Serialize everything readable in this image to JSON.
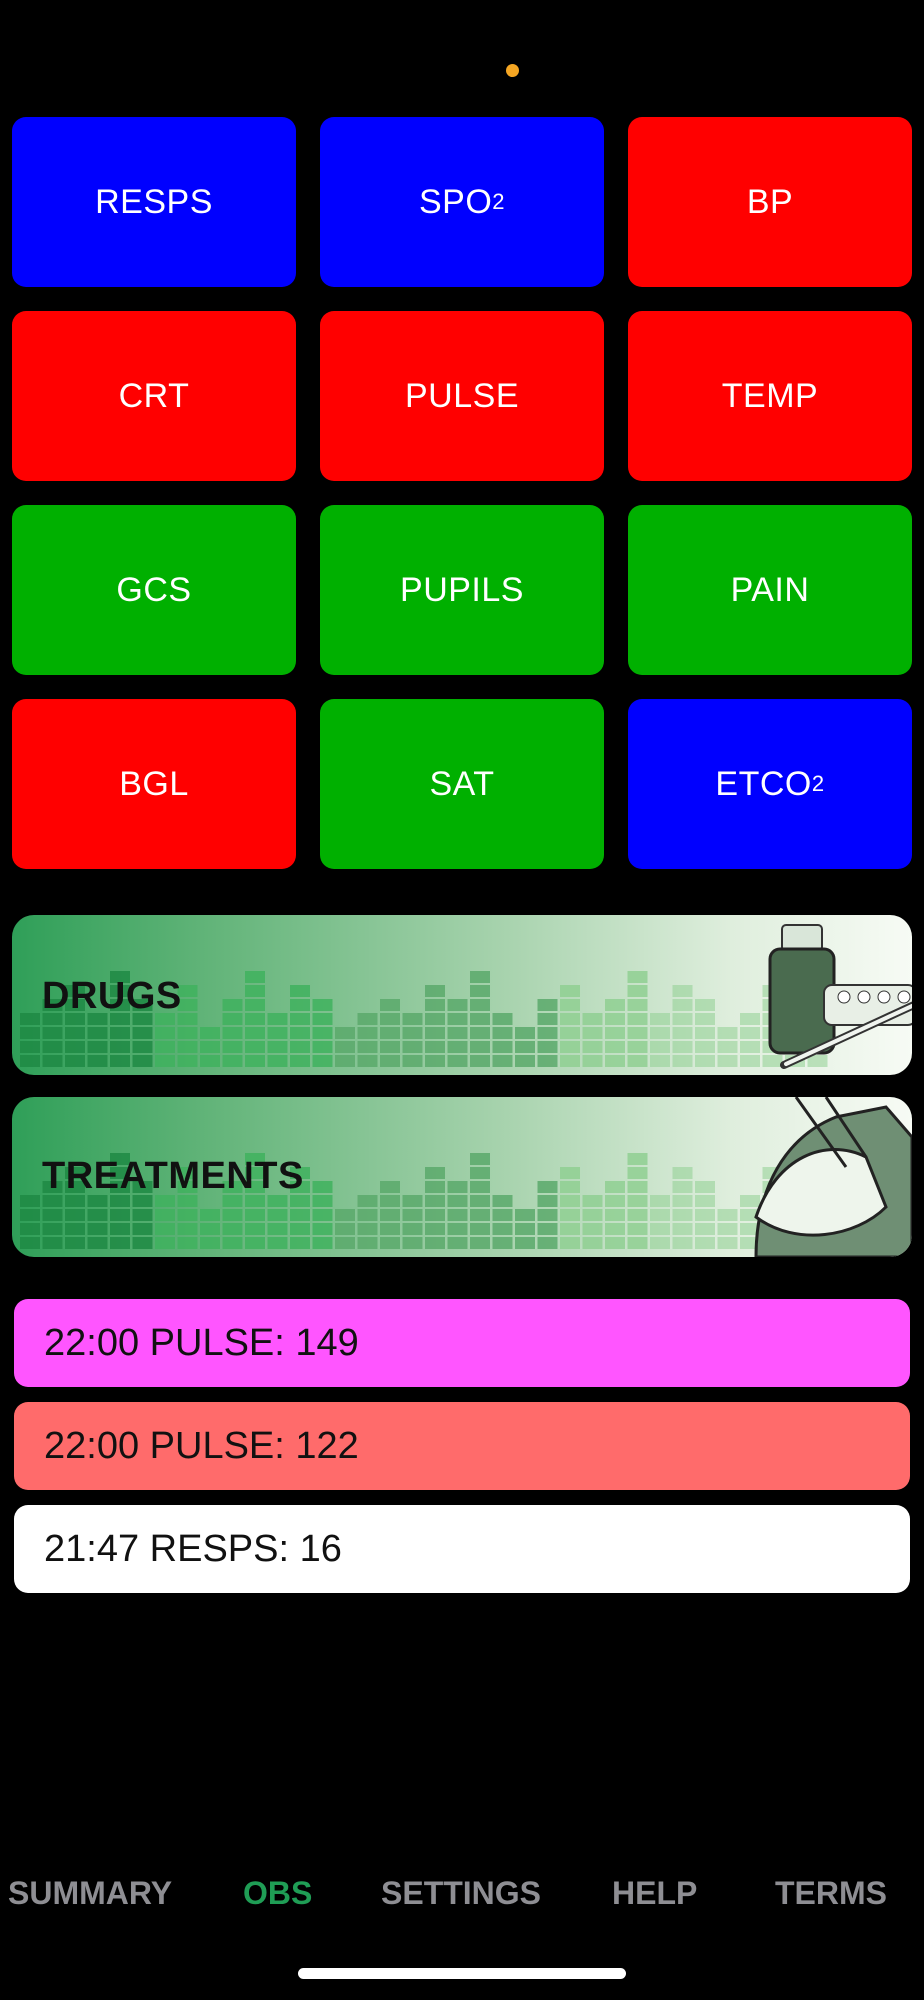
{
  "tiles": [
    {
      "label": "RESPS",
      "sub": "",
      "color": "#0000ff"
    },
    {
      "label": "SPO",
      "sub": "2",
      "color": "#0000ff"
    },
    {
      "label": "BP",
      "sub": "",
      "color": "#ff0000"
    },
    {
      "label": "CRT",
      "sub": "",
      "color": "#ff0000"
    },
    {
      "label": "PULSE",
      "sub": "",
      "color": "#ff0000"
    },
    {
      "label": "TEMP",
      "sub": "",
      "color": "#ff0000"
    },
    {
      "label": "GCS",
      "sub": "",
      "color": "#00b000"
    },
    {
      "label": "PUPILS",
      "sub": "",
      "color": "#00b000"
    },
    {
      "label": "PAIN",
      "sub": "",
      "color": "#00b000"
    },
    {
      "label": "BGL",
      "sub": "",
      "color": "#ff0000"
    },
    {
      "label": "SAT",
      "sub": "",
      "color": "#00b000"
    },
    {
      "label": "ETCO",
      "sub": "2",
      "color": "#0000ff"
    }
  ],
  "banners": {
    "drugs": {
      "label": "DRUGS"
    },
    "treatments": {
      "label": "TREATMENTS"
    }
  },
  "log": [
    {
      "text": "22:00 PULSE: 149",
      "color": "#ff55ff"
    },
    {
      "text": "22:00 PULSE: 122",
      "color": "#ff6b6b"
    },
    {
      "text": "21:47 RESPS: 16",
      "color": "#ffffff"
    }
  ],
  "tabs": {
    "summary": "SUMMARY",
    "obs": "OBS",
    "settings": "SETTINGS",
    "help": "HELP",
    "terms": "TERMS",
    "active_color": "#1f9d55",
    "inactive_color": "#8e8e93"
  }
}
